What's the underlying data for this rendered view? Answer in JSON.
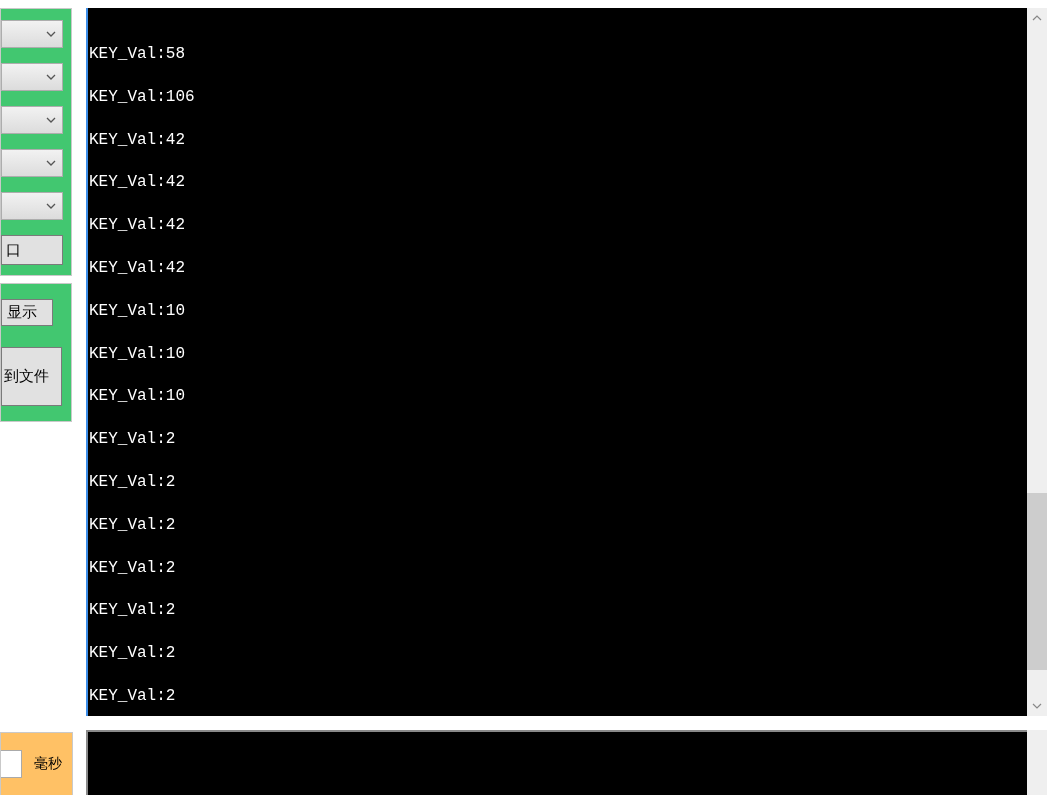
{
  "serial_settings": {
    "dropdowns": [
      {
        "kind": "dropdown"
      },
      {
        "kind": "dropdown"
      },
      {
        "kind": "dropdown"
      },
      {
        "kind": "dropdown"
      },
      {
        "kind": "dropdown"
      }
    ],
    "port_button": "口"
  },
  "display_controls": {
    "stop_button": "显示",
    "save_button": "到文件"
  },
  "timer": {
    "unit": "毫秒"
  },
  "receive_log": {
    "lines": [
      "KEY_Val:58",
      "KEY_Val:106",
      "KEY_Val:42",
      "KEY_Val:42",
      "KEY_Val:42",
      "KEY_Val:42",
      "KEY_Val:10",
      "KEY_Val:10",
      "KEY_Val:10",
      "KEY_Val:2",
      "KEY_Val:2",
      "KEY_Val:2",
      "KEY_Val:2",
      "KEY_Val:2",
      "KEY_Val:2",
      "KEY_Val:2"
    ]
  }
}
